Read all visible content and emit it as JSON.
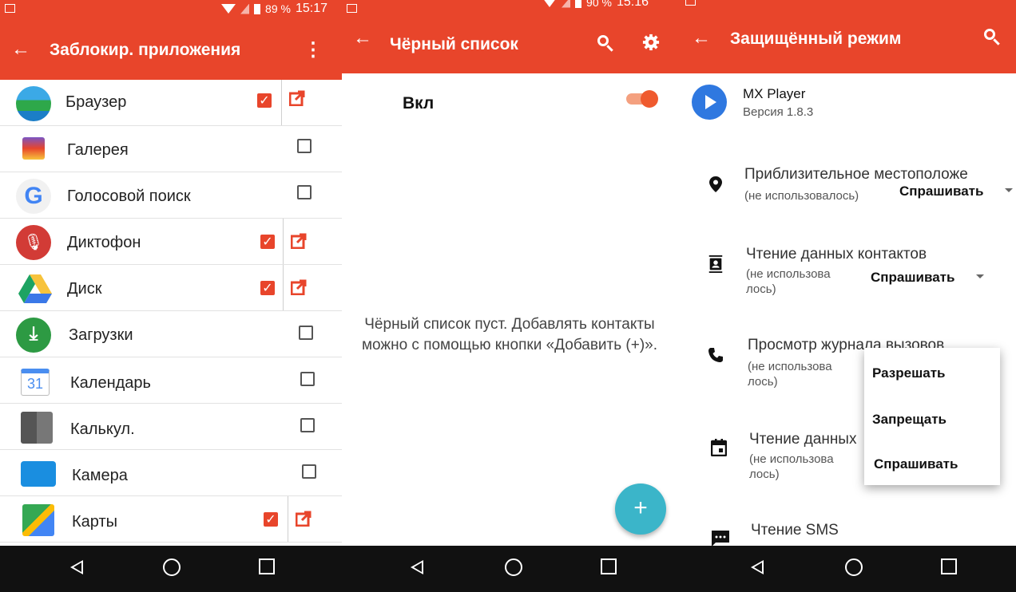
{
  "screen1": {
    "status": {
      "battery": "89 %",
      "time": "15:17"
    },
    "appbar": {
      "title": "Заблокир. приложения"
    },
    "apps": [
      {
        "name": "Браузер",
        "checked": true,
        "launcher": true
      },
      {
        "name": "Галерея",
        "checked": false,
        "launcher": false
      },
      {
        "name": "Голосовой поиск",
        "checked": false,
        "launcher": false
      },
      {
        "name": "Диктофон",
        "checked": true,
        "launcher": true
      },
      {
        "name": "Диск",
        "checked": true,
        "launcher": true
      },
      {
        "name": "Загрузки",
        "checked": false,
        "launcher": false
      },
      {
        "name": "Календарь",
        "checked": false,
        "launcher": false,
        "icon_text": "31"
      },
      {
        "name": "Калькул.",
        "checked": false,
        "launcher": false
      },
      {
        "name": "Камера",
        "checked": false,
        "launcher": false
      },
      {
        "name": "Карты",
        "checked": true,
        "launcher": true
      }
    ]
  },
  "screen2": {
    "status": {
      "battery": "90 %",
      "time": "15:16"
    },
    "appbar": {
      "title": "Чёрный список"
    },
    "toggle_label": "Вкл",
    "toggle_on": true,
    "empty_message": "Чёрный список пуст. Добавлять контакты можно с помощью кнопки «Добавить (+)».",
    "fab_label": "+"
  },
  "screen3": {
    "appbar": {
      "title": "Защищённый режим"
    },
    "app": {
      "name": "MX Player",
      "version": "Версия 1.8.3"
    },
    "permissions": [
      {
        "title": "Приблизительное местоположе",
        "sub": "(не использовалось)",
        "value": "Спрашивать"
      },
      {
        "title": "Чтение данных контактов",
        "sub": "(не использова лось)",
        "value": "Спрашивать"
      },
      {
        "title": "Просмотр журнала вызовов",
        "sub": "(не использова лось)",
        "value": ""
      },
      {
        "title": "Чтение данных",
        "sub": "(не использова лось)",
        "value": ""
      },
      {
        "title": "Чтение SMS",
        "sub": "",
        "value": ""
      }
    ],
    "menu": [
      "Разрешать",
      "Запрещать",
      "Спрашивать"
    ]
  },
  "colors": {
    "accent": "#e8452b",
    "fab": "#3bb5c9",
    "play": "#2f78e0"
  }
}
